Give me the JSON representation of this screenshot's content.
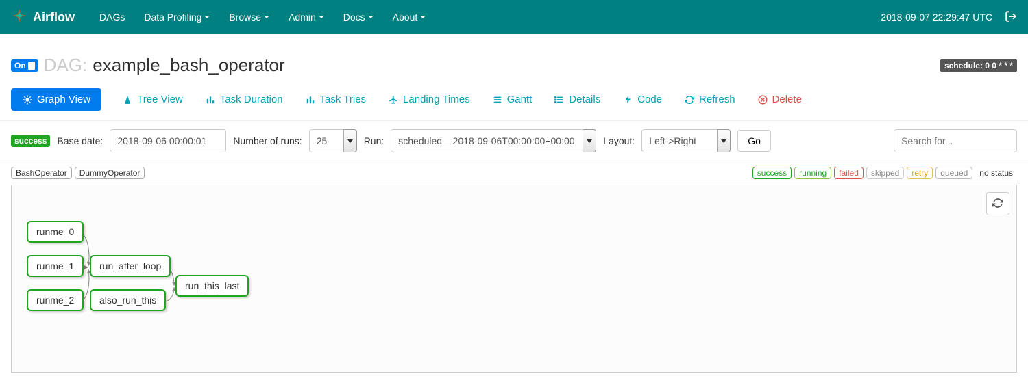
{
  "brand": "Airflow",
  "nav_items": [
    "DAGs",
    "Data Profiling",
    "Browse",
    "Admin",
    "Docs",
    "About"
  ],
  "nav_dropdowns": [
    false,
    true,
    true,
    true,
    true,
    true
  ],
  "clock": "2018-09-07 22:29:47 UTC",
  "dag": {
    "toggle": "On",
    "label": "DAG:",
    "id": "example_bash_operator",
    "schedule": "schedule: 0 0 * * *"
  },
  "tabs": {
    "graph_view": "Graph View",
    "tree_view": "Tree View",
    "task_duration": "Task Duration",
    "task_tries": "Task Tries",
    "landing_times": "Landing Times",
    "gantt": "Gantt",
    "details": "Details",
    "code": "Code",
    "refresh": "Refresh",
    "delete": "Delete"
  },
  "controls": {
    "run_status": "success",
    "base_date_label": "Base date:",
    "base_date": "2018-09-06 00:00:01",
    "num_runs_label": "Number of runs:",
    "num_runs": "25",
    "run_label": "Run:",
    "run": "scheduled__2018-09-06T00:00:00+00:00",
    "layout_label": "Layout:",
    "layout": "Left->Right",
    "go": "Go",
    "search_placeholder": "Search for..."
  },
  "operators": [
    "BashOperator",
    "DummyOperator"
  ],
  "states": {
    "success": "success",
    "running": "running",
    "failed": "failed",
    "skipped": "skipped",
    "retry": "retry",
    "queued": "queued",
    "no_status": "no status"
  },
  "graph_nodes": {
    "runme_0": "runme_0",
    "runme_1": "runme_1",
    "runme_2": "runme_2",
    "run_after_loop": "run_after_loop",
    "also_run_this": "also_run_this",
    "run_this_last": "run_this_last"
  }
}
